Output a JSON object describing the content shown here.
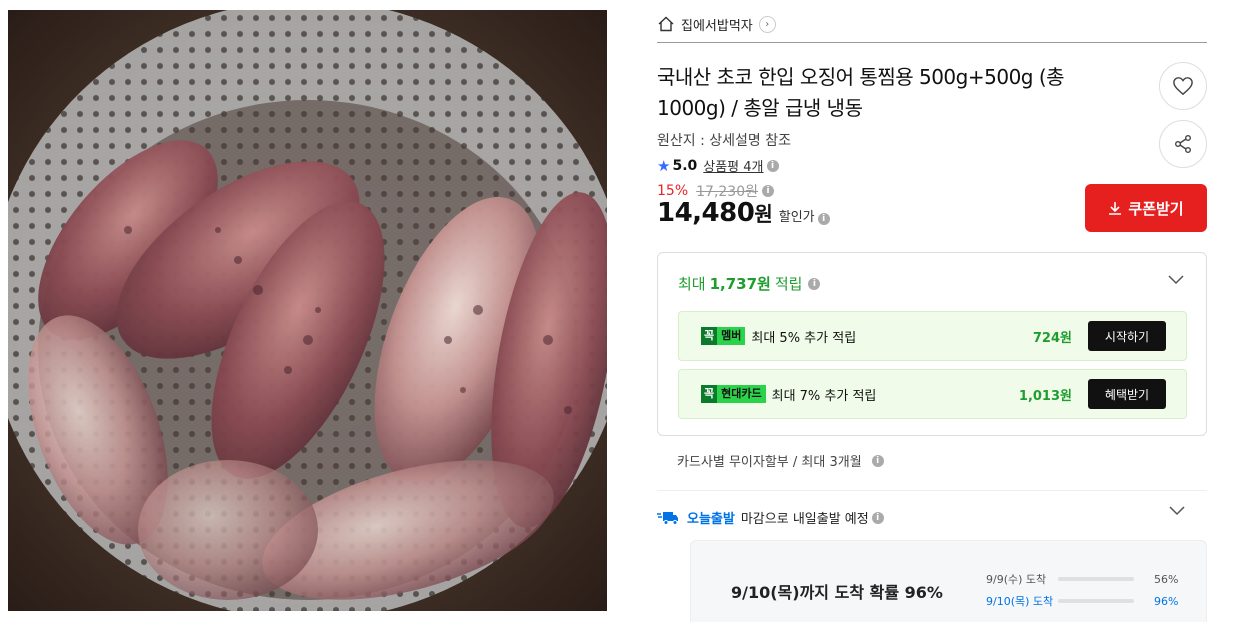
{
  "store": {
    "name": "집에서밥먹자"
  },
  "product": {
    "title": "국내산 초코 한입 오징어 통찜용 500g+500g (총 1000g) / 총알 급냉 냉동",
    "origin": "원산지 : 상세설명 참조",
    "rating": "5.0",
    "reviews": "상품평 4개"
  },
  "price": {
    "discount_rate": "15%",
    "original": "17,230원",
    "sale": "14,480",
    "won": "원",
    "sale_tag": "할인가",
    "coupon_label": "쿠폰받기"
  },
  "reward": {
    "prefix": "최대",
    "amount": "1,737원",
    "suffix": "적립",
    "items": [
      {
        "k": "꼭",
        "badge": "멤버",
        "desc": "최대 5% 추가 적립",
        "amount": "724원",
        "action": "시작하기"
      },
      {
        "k": "꼭",
        "badge": "현대카드",
        "desc": "최대 7% 추가 적립",
        "amount": "1,013원",
        "action": "혜택받기"
      }
    ]
  },
  "installment": "카드사별 무이자할부 / 최대 3개월",
  "shipping": {
    "badge": "오늘출발",
    "text": "마감으로 내일출발 예정",
    "eta_main": "9/10(목)까지 도착 확률 96%",
    "rows": [
      {
        "label": "9/9(수) 도착",
        "percent": "56%",
        "value": 56,
        "color": "#cfcfcf"
      },
      {
        "label": "9/10(목) 도착",
        "percent": "96%",
        "value": 96,
        "color": "#1a73e8"
      }
    ]
  },
  "icons": [
    "home-icon",
    "chevron-right-icon",
    "heart-icon",
    "share-icon",
    "star-icon",
    "info-icon",
    "download-icon",
    "chevron-down-icon",
    "truck-icon"
  ],
  "colors": {
    "accent_red": "#e5201f",
    "reward_green": "#1f9e2f",
    "shipping_blue": "#0073e9"
  }
}
